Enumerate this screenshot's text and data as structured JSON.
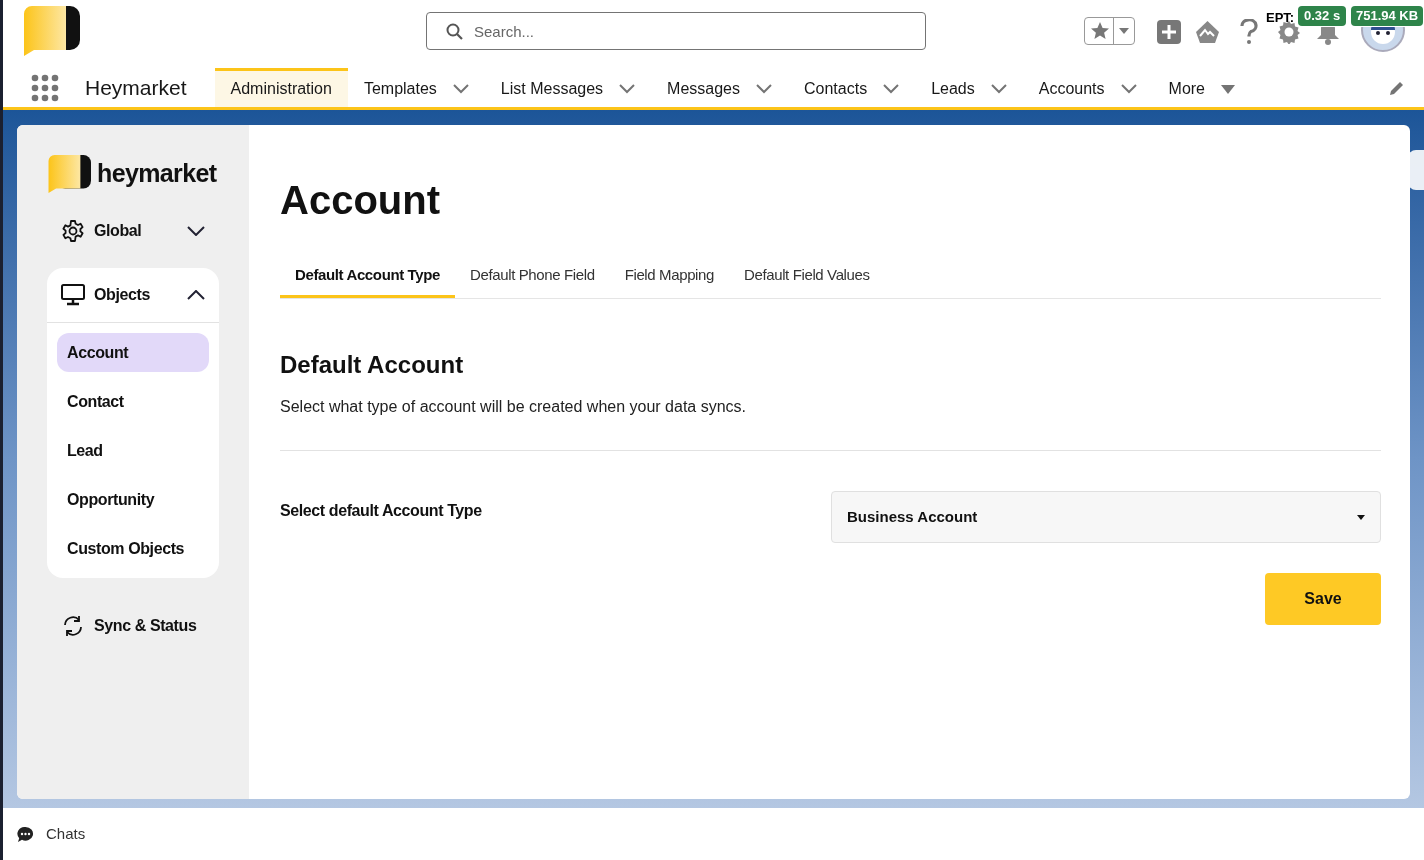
{
  "header": {
    "search": {
      "placeholder": "Search..."
    },
    "ept": {
      "label": "EPT:",
      "time": "0.32 s",
      "size": "751.94 KB"
    }
  },
  "nav": {
    "app_name": "Heymarket",
    "tabs": [
      {
        "label": "Administration",
        "selected": true,
        "kind": "link"
      },
      {
        "label": "Templates",
        "selected": false,
        "kind": "dropdown"
      },
      {
        "label": "List Messages",
        "selected": false,
        "kind": "dropdown"
      },
      {
        "label": "Messages",
        "selected": false,
        "kind": "dropdown"
      },
      {
        "label": "Contacts",
        "selected": false,
        "kind": "dropdown"
      },
      {
        "label": "Leads",
        "selected": false,
        "kind": "dropdown"
      },
      {
        "label": "Accounts",
        "selected": false,
        "kind": "dropdown"
      },
      {
        "label": "More",
        "selected": false,
        "kind": "overflow"
      }
    ]
  },
  "sidebar": {
    "brand": "heymarket",
    "sections": [
      {
        "label": "Global",
        "expanded": false
      },
      {
        "label": "Objects",
        "expanded": true,
        "items": [
          {
            "label": "Account",
            "selected": true
          },
          {
            "label": "Contact",
            "selected": false
          },
          {
            "label": "Lead",
            "selected": false
          },
          {
            "label": "Opportunity",
            "selected": false
          },
          {
            "label": "Custom Objects",
            "selected": false
          }
        ]
      },
      {
        "label": "Sync & Status",
        "expanded": false
      }
    ]
  },
  "page": {
    "title": "Account",
    "tabs": [
      {
        "label": "Default Account Type",
        "selected": true
      },
      {
        "label": "Default Phone Field",
        "selected": false
      },
      {
        "label": "Field Mapping",
        "selected": false
      },
      {
        "label": "Default Field Values",
        "selected": false
      }
    ],
    "section_title": "Default Account",
    "description": "Select what type of account will be created when your data syncs.",
    "field": {
      "label": "Select default Account Type",
      "value": "Business Account"
    },
    "save_button": "Save"
  },
  "footer": {
    "label": "Chats"
  }
}
